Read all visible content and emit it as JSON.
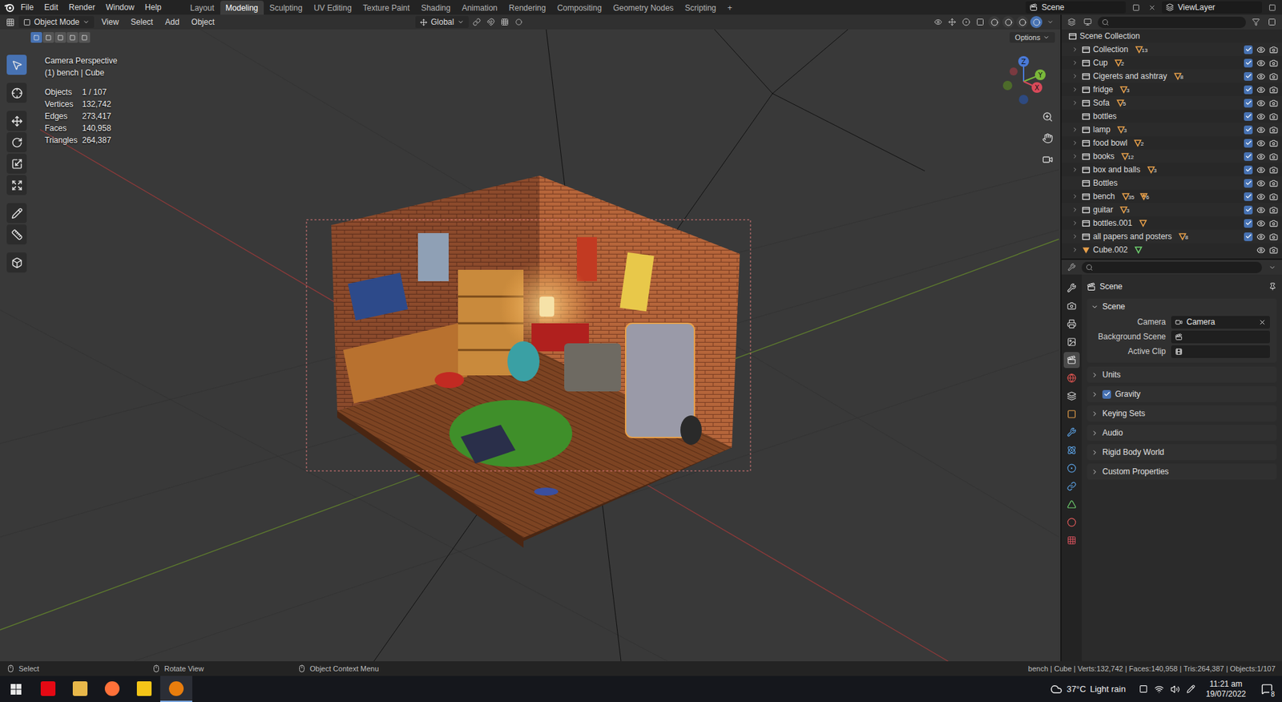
{
  "menu": [
    "File",
    "Edit",
    "Render",
    "Window",
    "Help"
  ],
  "workspaces": [
    {
      "label": "Layout",
      "selected": false
    },
    {
      "label": "Modeling",
      "selected": true
    },
    {
      "label": "Sculpting",
      "selected": false
    },
    {
      "label": "UV Editing",
      "selected": false
    },
    {
      "label": "Texture Paint",
      "selected": false
    },
    {
      "label": "Shading",
      "selected": false
    },
    {
      "label": "Animation",
      "selected": false
    },
    {
      "label": "Rendering",
      "selected": false
    },
    {
      "label": "Compositing",
      "selected": false
    },
    {
      "label": "Geometry Nodes",
      "selected": false
    },
    {
      "label": "Scripting",
      "selected": false
    }
  ],
  "add_workspace": "+",
  "scene": "Scene",
  "view_layer": "ViewLayer",
  "viewport_header": {
    "mode": "Object Mode",
    "menus": [
      "View",
      "Select",
      "Add",
      "Object"
    ],
    "orientation": "Global",
    "options": "Options",
    "select_modes": [
      {
        "selected": true
      },
      {
        "selected": false
      },
      {
        "selected": false
      },
      {
        "selected": false
      },
      {
        "selected": false
      }
    ],
    "shading_modes": [
      {
        "selected": false
      },
      {
        "selected": false
      },
      {
        "selected": false
      },
      {
        "selected": true
      }
    ]
  },
  "overlay": {
    "view": "Camera Perspective",
    "active": "(1) bench | Cube",
    "stats": [
      {
        "label": "Objects",
        "value": "1 / 107"
      },
      {
        "label": "Vertices",
        "value": "132,742"
      },
      {
        "label": "Edges",
        "value": "273,417"
      },
      {
        "label": "Faces",
        "value": "140,958"
      },
      {
        "label": "Triangles",
        "value": "264,387"
      }
    ]
  },
  "tools": [
    {
      "selected": true
    },
    {
      "selected": false
    },
    {
      "selected": false
    },
    {
      "selected": false
    },
    {
      "selected": false
    },
    {
      "selected": false
    },
    {
      "selected": false
    },
    {
      "selected": false
    },
    {
      "selected": false
    }
  ],
  "gizmo": {
    "axes": [
      "X",
      "Y",
      "Z"
    ]
  },
  "outliner": {
    "root": "Scene Collection",
    "items": [
      {
        "name": "Collection",
        "kind": "collection",
        "expandable": true,
        "checked": true,
        "badges": [
          {
            "kind": "mesh",
            "count": "13"
          }
        ]
      },
      {
        "name": "Cup",
        "kind": "collection",
        "expandable": true,
        "checked": true,
        "badges": [
          {
            "kind": "mesh",
            "count": "2"
          }
        ]
      },
      {
        "name": "Cigerets and ashtray",
        "kind": "collection",
        "expandable": true,
        "checked": true,
        "badges": [
          {
            "kind": "mesh",
            "count": "8"
          }
        ]
      },
      {
        "name": "fridge",
        "kind": "collection",
        "expandable": true,
        "checked": true,
        "badges": [
          {
            "kind": "mesh",
            "count": "3"
          }
        ]
      },
      {
        "name": "Sofa",
        "kind": "collection",
        "expandable": true,
        "checked": true,
        "badges": [
          {
            "kind": "mesh",
            "count": "5"
          }
        ]
      },
      {
        "name": "bottles",
        "kind": "collection",
        "expandable": false,
        "checked": true,
        "badges": []
      },
      {
        "name": "lamp",
        "kind": "collection",
        "expandable": true,
        "checked": true,
        "badges": [
          {
            "kind": "mesh",
            "count": "3"
          }
        ]
      },
      {
        "name": "food bowl",
        "kind": "collection",
        "expandable": true,
        "checked": true,
        "badges": [
          {
            "kind": "mesh",
            "count": "2"
          }
        ]
      },
      {
        "name": "books",
        "kind": "collection",
        "expandable": true,
        "checked": true,
        "badges": [
          {
            "kind": "mesh",
            "count": "12"
          }
        ]
      },
      {
        "name": "box and balls",
        "kind": "collection",
        "expandable": true,
        "checked": true,
        "badges": [
          {
            "kind": "mesh",
            "count": "3"
          }
        ]
      },
      {
        "name": "Bottles",
        "kind": "collection",
        "expandable": false,
        "checked": true,
        "badges": []
      },
      {
        "name": "bench",
        "kind": "collection",
        "expandable": true,
        "checked": true,
        "badges": [
          {
            "kind": "mesh",
            "count": "35"
          },
          {
            "kind": "empty",
            "count": "6"
          }
        ]
      },
      {
        "name": "guitar",
        "kind": "collection",
        "expandable": true,
        "checked": true,
        "badges": [
          {
            "kind": "mesh",
            "count": "3"
          }
        ]
      },
      {
        "name": "bottles.001",
        "kind": "collection",
        "expandable": true,
        "checked": true,
        "badges": [
          {
            "kind": "mesh",
            "count": ""
          }
        ]
      },
      {
        "name": "all papers and posters",
        "kind": "collection",
        "expandable": true,
        "checked": true,
        "badges": [
          {
            "kind": "mesh",
            "count": "8"
          }
        ]
      },
      {
        "name": "Cube.002",
        "kind": "object",
        "expandable": true,
        "checked": false,
        "badges": [
          {
            "kind": "data",
            "count": ""
          }
        ]
      }
    ]
  },
  "properties": {
    "tabs": [
      {
        "selected": false
      },
      {
        "selected": false
      },
      {
        "selected": false
      },
      {
        "selected": false
      },
      {
        "selected": true
      },
      {
        "selected": false
      },
      {
        "selected": false
      },
      {
        "selected": false
      },
      {
        "selected": false
      },
      {
        "selected": false
      },
      {
        "selected": false
      },
      {
        "selected": false
      },
      {
        "selected": false
      },
      {
        "selected": false
      },
      {
        "selected": false
      }
    ],
    "breadcrumb": "Scene",
    "section": {
      "label": "Scene",
      "expanded": true
    },
    "fields": [
      {
        "label": "Camera",
        "value": "Camera",
        "clearable": true
      },
      {
        "label": "Background Scene",
        "value": "",
        "clearable": false
      },
      {
        "label": "Active Clip",
        "value": "",
        "clearable": false
      }
    ],
    "panels": [
      {
        "label": "Units",
        "kind": "plain",
        "checked": false
      },
      {
        "label": "Gravity",
        "kind": "checkbox",
        "checked": true
      },
      {
        "label": "Keying Sets",
        "kind": "plain",
        "checked": false
      },
      {
        "label": "Audio",
        "kind": "plain",
        "checked": false
      },
      {
        "label": "Rigid Body World",
        "kind": "plain",
        "checked": false
      },
      {
        "label": "Custom Properties",
        "kind": "plain",
        "checked": false
      }
    ]
  },
  "status_bar": {
    "hints": [
      "Select",
      "Rotate View",
      "Object Context Menu"
    ],
    "info": "bench | Cube | Verts:132,742 | Faces:140,958 | Tris:264,387 | Objects:1/107"
  },
  "taskbar": {
    "apps": [
      {
        "color": "#e50914",
        "active": false
      },
      {
        "color": "#e8b84a",
        "active": false
      },
      {
        "color": "#ff7139",
        "active": false
      },
      {
        "color": "#f5c518",
        "active": false
      },
      {
        "color": "#e87d0d",
        "active": true
      }
    ],
    "temperature": "37°C",
    "weather": "Light rain",
    "time": "11:21 am",
    "date": "19/07/2022",
    "notifications": "8"
  }
}
